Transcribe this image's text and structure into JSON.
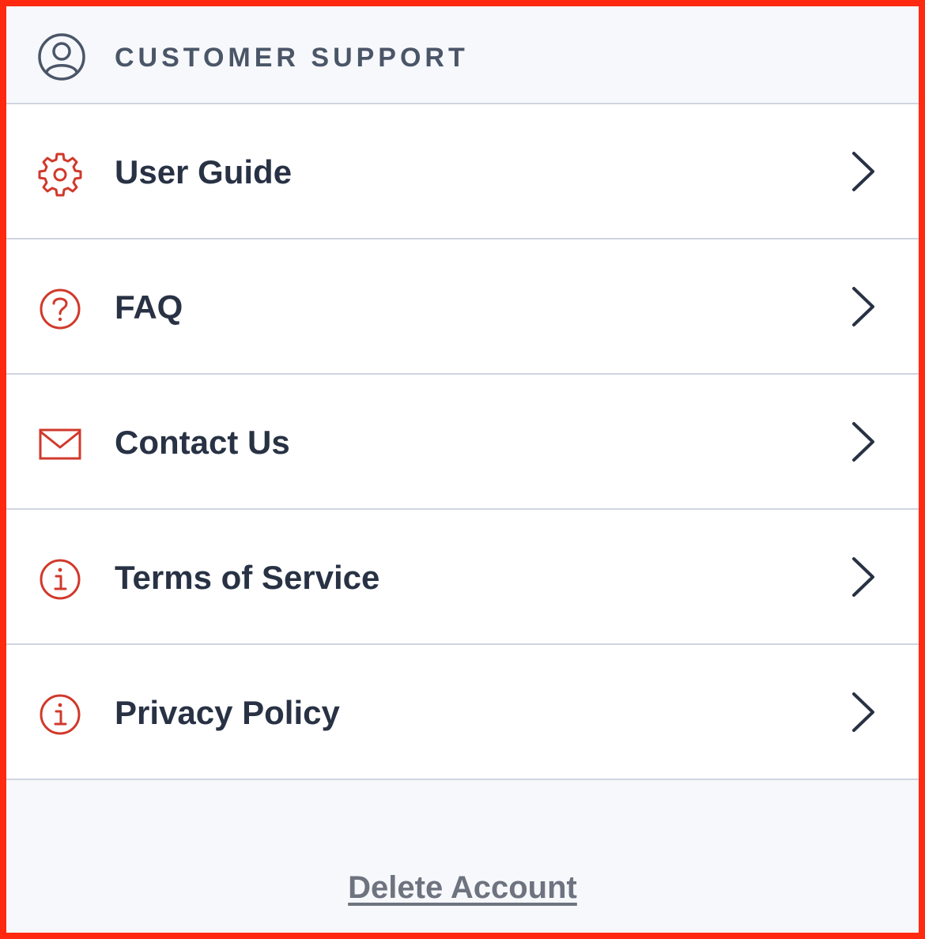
{
  "header": {
    "title": "CUSTOMER SUPPORT",
    "icon": "user-circle-icon"
  },
  "menu": {
    "items": [
      {
        "label": "User Guide",
        "icon": "gear-icon"
      },
      {
        "label": "FAQ",
        "icon": "question-circle-icon"
      },
      {
        "label": "Contact Us",
        "icon": "envelope-icon"
      },
      {
        "label": "Terms of Service",
        "icon": "info-circle-icon"
      },
      {
        "label": "Privacy Policy",
        "icon": "info-circle-icon"
      }
    ]
  },
  "footer": {
    "delete_label": "Delete Account"
  },
  "colors": {
    "accent": "#d0392b",
    "text": "#283244",
    "header_text": "#4a5668",
    "border": "#ff2a10",
    "divider": "#cfd5df",
    "link": "#6e7380"
  }
}
